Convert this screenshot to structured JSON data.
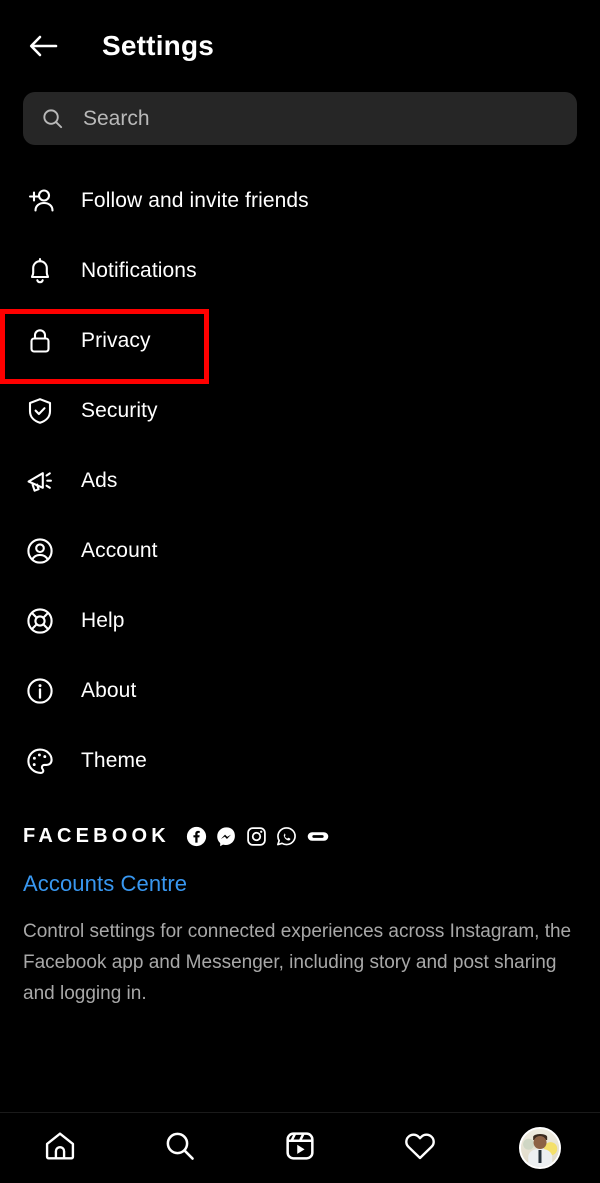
{
  "header": {
    "back_icon": "arrow-left-icon",
    "title": "Settings"
  },
  "search": {
    "icon": "search-icon",
    "placeholder": "Search",
    "value": ""
  },
  "menu": {
    "items": [
      {
        "label": "Follow and invite friends",
        "icon": "person-add-icon",
        "highlighted": false
      },
      {
        "label": "Notifications",
        "icon": "bell-icon",
        "highlighted": false
      },
      {
        "label": "Privacy",
        "icon": "lock-icon",
        "highlighted": true
      },
      {
        "label": "Security",
        "icon": "shield-check-icon",
        "highlighted": false
      },
      {
        "label": "Ads",
        "icon": "megaphone-icon",
        "highlighted": false
      },
      {
        "label": "Account",
        "icon": "person-circle-icon",
        "highlighted": false
      },
      {
        "label": "Help",
        "icon": "lifebuoy-icon",
        "highlighted": false
      },
      {
        "label": "About",
        "icon": "info-circle-icon",
        "highlighted": false
      },
      {
        "label": "Theme",
        "icon": "palette-icon",
        "highlighted": false
      }
    ]
  },
  "facebook_section": {
    "brand_label": "FACEBOOK",
    "brand_icons": [
      "facebook-icon",
      "messenger-icon",
      "instagram-icon",
      "whatsapp-icon",
      "oculus-icon"
    ],
    "link_label": "Accounts Centre",
    "description": "Control settings for connected experiences across Instagram, the Facebook app and Messenger, including story and post sharing and logging in."
  },
  "bottom_nav": {
    "items": [
      {
        "icon": "home-icon",
        "name": "nav-home"
      },
      {
        "icon": "search-icon",
        "name": "nav-search"
      },
      {
        "icon": "reels-icon",
        "name": "nav-reels"
      },
      {
        "icon": "heart-icon",
        "name": "nav-activity"
      },
      {
        "icon": "avatar-icon",
        "name": "nav-profile"
      }
    ]
  },
  "colors": {
    "background": "#000000",
    "text_primary": "#ffffff",
    "text_secondary": "#a8a8a8",
    "link": "#3897f0",
    "search_field": "#262626",
    "highlight_box": "#ff0000"
  }
}
